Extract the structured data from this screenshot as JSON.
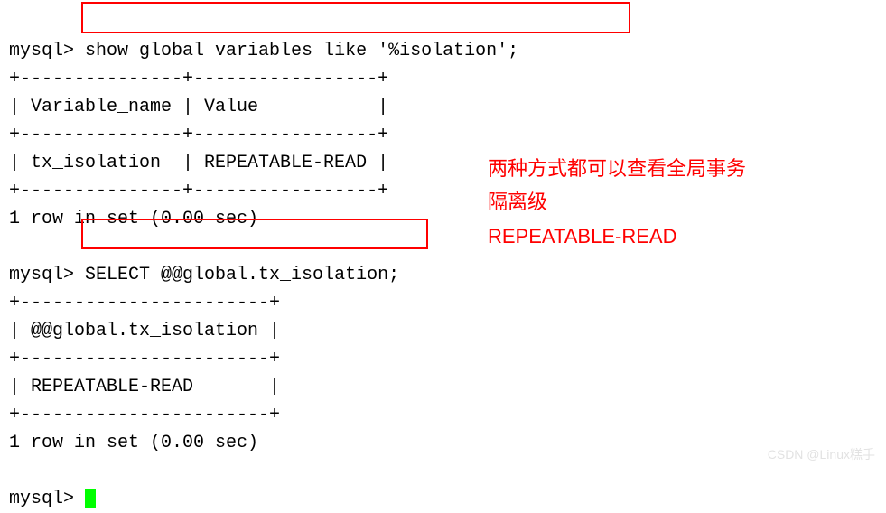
{
  "terminal": {
    "prompt1": "mysql>",
    "command1": " show global variables like '%isolation';",
    "divider1": "+---------------+-----------------+",
    "header1": "| Variable_name | Value           |",
    "divider2": "+---------------+-----------------+",
    "row1": "| tx_isolation  | REPEATABLE-READ |",
    "divider3": "+---------------+-----------------+",
    "result1": "1 row in set (0.00 sec)",
    "blank1": "",
    "prompt2": "mysql>",
    "command2": " SELECT @@global.tx_isolation;",
    "divider4": "+-----------------------+",
    "header2": "| @@global.tx_isolation |",
    "divider5": "+-----------------------+",
    "row2": "| REPEATABLE-READ       |",
    "divider6": "+-----------------------+",
    "result2": "1 row in set (0.00 sec)",
    "blank2": "",
    "prompt3": "mysql> "
  },
  "annotation": {
    "line1": "两种方式都可以查看全局事务",
    "line2": "隔离级",
    "line3": "REPEATABLE-READ"
  },
  "watermark": "CSDN @Linux糕手"
}
